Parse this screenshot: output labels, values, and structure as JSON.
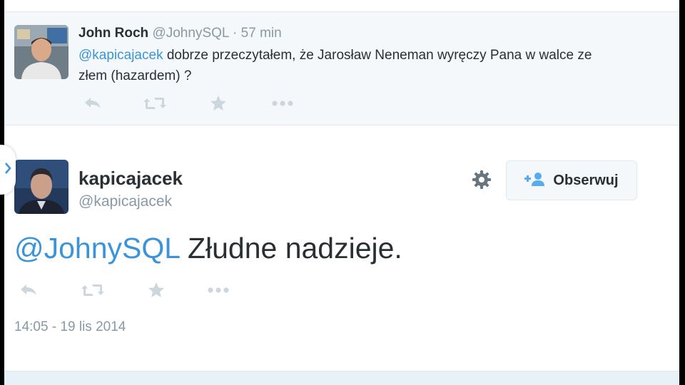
{
  "colors": {
    "mention": "#3b94d9",
    "muted": "#8899a6",
    "text": "#292f33",
    "icon": "#ccd6dd"
  },
  "reply_tweet": {
    "fullname": "John Roch",
    "handle": "@JohnySQL",
    "separator": "·",
    "time": "57 min",
    "mention": "@kapicajacek",
    "text": " dobrze przeczytałem, że Jarosław Neneman wyręczy Pana w walce ze złem (hazardem) ?",
    "actions": [
      "reply-icon",
      "retweet-icon",
      "favorite-icon",
      "more-icon"
    ]
  },
  "main_tweet": {
    "fullname": "kapicajacek",
    "handle": "@kapicajacek",
    "follow_label": "Obserwuj",
    "mention": "@JohnySQL",
    "text": " Złudne nadzieje.",
    "timestamp": "14:05 - 19 lis 2014",
    "actions": [
      "reply-icon",
      "retweet-icon",
      "favorite-icon",
      "more-icon"
    ]
  }
}
